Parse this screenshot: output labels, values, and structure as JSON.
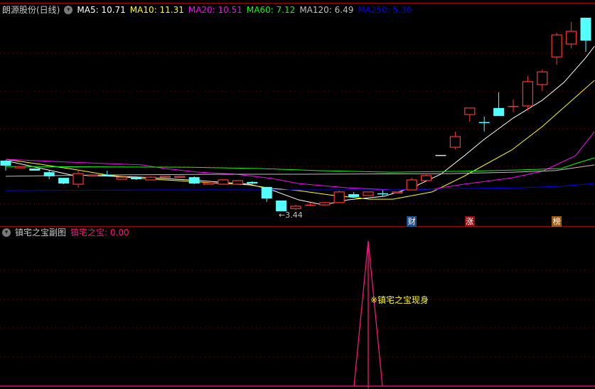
{
  "main_header": {
    "stock": "朗源股份(日线)",
    "ma_labels": [
      {
        "text": "MA5: 10.71",
        "color": "#ffffff"
      },
      {
        "text": "MA10: 11.31",
        "color": "#ffff00"
      },
      {
        "text": "MA20: 10.51",
        "color": "#ff00ff"
      },
      {
        "text": "MA60: 7.12",
        "color": "#00ff00"
      },
      {
        "text": "MA120: 6.49",
        "color": "#c0c0c0"
      },
      {
        "text": "MA250: 5.36",
        "color": "#0000ff"
      }
    ]
  },
  "sub_header": {
    "title": "镇宅之宝副图",
    "value_label": "镇宅之宝: 0.00"
  },
  "annotations": {
    "low": "←3.44",
    "signal": "※镇宅之宝现身",
    "tags": [
      {
        "text": "财",
        "bar": 28,
        "color": "#1c4f8c"
      },
      {
        "text": "涨",
        "bar": 32,
        "color": "#9a0e0e"
      },
      {
        "text": "榜",
        "bar": 38,
        "color": "#9c5a14"
      }
    ]
  },
  "colors": {
    "up": "#ff3232",
    "down": "#54ffff",
    "grid": "#8b0000",
    "sub_line": "#ff1080"
  },
  "chart_data": [
    {
      "type": "candlestick",
      "title": "朗源股份(日线)",
      "ylim": [
        3.1,
        12.0
      ],
      "ohlc": [
        [
          5.67,
          5.67,
          5.23,
          5.45
        ],
        [
          5.35,
          5.41,
          5.35,
          5.41
        ],
        [
          5.32,
          5.32,
          5.23,
          5.23
        ],
        [
          5.16,
          5.23,
          4.85,
          4.98
        ],
        [
          4.91,
          4.91,
          4.63,
          4.66
        ],
        [
          4.63,
          5.26,
          4.47,
          5.1
        ],
        [
          5.01,
          5.04,
          5.01,
          5.04
        ],
        [
          5.04,
          5.23,
          4.98,
          5.01
        ],
        [
          4.85,
          4.94,
          4.85,
          4.94
        ],
        [
          4.94,
          4.98,
          4.82,
          4.85
        ],
        [
          4.82,
          4.98,
          4.82,
          4.94
        ],
        [
          4.96,
          4.98,
          4.96,
          4.98
        ],
        [
          4.94,
          5.01,
          4.94,
          4.98
        ],
        [
          4.94,
          4.98,
          4.63,
          4.66
        ],
        [
          4.63,
          4.69,
          4.63,
          4.69
        ],
        [
          4.63,
          4.85,
          4.6,
          4.82
        ],
        [
          4.63,
          4.82,
          4.6,
          4.79
        ],
        [
          4.73,
          4.76,
          4.63,
          4.66
        ],
        [
          4.51,
          4.51,
          3.85,
          4.0
        ],
        [
          3.91,
          3.91,
          3.44,
          3.44
        ],
        [
          3.55,
          3.72,
          3.5,
          3.66
        ],
        [
          3.72,
          3.82,
          3.66,
          3.73
        ],
        [
          3.72,
          3.85,
          3.7,
          3.82
        ],
        [
          3.82,
          4.35,
          3.8,
          4.29
        ],
        [
          4.19,
          4.29,
          4.05,
          4.07
        ],
        [
          4.13,
          4.3,
          4.13,
          4.29
        ],
        [
          4.23,
          4.38,
          4.1,
          4.22
        ],
        [
          4.26,
          4.29,
          4.26,
          4.29
        ],
        [
          4.38,
          4.91,
          4.38,
          4.82
        ],
        [
          4.79,
          5.1,
          4.79,
          5.01
        ],
        [
          5.92,
          5.92,
          5.92,
          5.92
        ],
        [
          6.26,
          6.95,
          6.17,
          6.73
        ],
        [
          7.7,
          7.99,
          7.39,
          7.99
        ],
        [
          7.37,
          7.61,
          6.95,
          7.36
        ],
        [
          7.99,
          8.68,
          7.64,
          7.64
        ],
        [
          8.07,
          8.36,
          7.8,
          8.08
        ],
        [
          8.08,
          9.4,
          7.89,
          9.15
        ],
        [
          9.02,
          9.68,
          8.74,
          9.58
        ],
        [
          10.24,
          11.31,
          9.9,
          11.21
        ],
        [
          10.81,
          11.78,
          10.62,
          11.37
        ],
        [
          11.97,
          11.97,
          10.46,
          10.96
        ]
      ],
      "series": [
        {
          "name": "MA5",
          "color": "#ffffff",
          "points": [
            [
              0,
              5.67
            ],
            [
              4.5,
              5.04
            ],
            [
              9.4,
              4.94
            ],
            [
              13.3,
              4.79
            ],
            [
              16.8,
              4.63
            ],
            [
              18.2,
              4.41
            ],
            [
              20.2,
              3.94
            ],
            [
              21.9,
              3.72
            ],
            [
              23.6,
              3.94
            ],
            [
              26.1,
              4.1
            ],
            [
              28,
              4.47
            ],
            [
              30,
              5.07
            ],
            [
              31.5,
              5.82
            ],
            [
              33,
              6.61
            ],
            [
              35,
              7.55
            ],
            [
              37,
              8.33
            ],
            [
              38.5,
              9.12
            ],
            [
              40,
              10.21
            ],
            [
              40.6,
              10.71
            ]
          ]
        },
        {
          "name": "MA10",
          "color": "#ffff00",
          "points": [
            [
              0,
              5.73
            ],
            [
              2.4,
              5.51
            ],
            [
              4.66,
              5.29
            ],
            [
              7,
              5.04
            ],
            [
              8.8,
              4.91
            ],
            [
              11,
              4.82
            ],
            [
              14.3,
              4.69
            ],
            [
              16.8,
              4.6
            ],
            [
              18.4,
              4.44
            ],
            [
              20.2,
              4.35
            ],
            [
              22.3,
              4.16
            ],
            [
              25.1,
              3.97
            ],
            [
              26.7,
              3.97
            ],
            [
              29.4,
              4.29
            ],
            [
              31.6,
              4.98
            ],
            [
              34.9,
              6.14
            ],
            [
              37,
              7.17
            ],
            [
              40.6,
              9.21
            ]
          ]
        },
        {
          "name": "MA20",
          "color": "#ff00ff",
          "points": [
            [
              0,
              5.73
            ],
            [
              4.5,
              5.6
            ],
            [
              9.4,
              5.48
            ],
            [
              11,
              5.32
            ],
            [
              13.3,
              5.16
            ],
            [
              15.9,
              5.07
            ],
            [
              18.4,
              4.88
            ],
            [
              20.2,
              4.66
            ],
            [
              23.6,
              4.47
            ],
            [
              26.7,
              4.38
            ],
            [
              29.4,
              4.41
            ],
            [
              31.6,
              4.63
            ],
            [
              34.9,
              4.91
            ],
            [
              37,
              5.2
            ],
            [
              39.3,
              5.89
            ],
            [
              40.6,
              6.95
            ]
          ]
        },
        {
          "name": "MA60",
          "color": "#00ff00",
          "points": [
            [
              0,
              5.41
            ],
            [
              12.5,
              5.38
            ],
            [
              17.6,
              5.32
            ],
            [
              21.5,
              5.23
            ],
            [
              26.6,
              5.16
            ],
            [
              31.5,
              5.2
            ],
            [
              35.4,
              5.26
            ],
            [
              38.3,
              5.32
            ],
            [
              39.3,
              5.54
            ],
            [
              40.6,
              5.79
            ]
          ]
        },
        {
          "name": "MA120",
          "color": "#c0c0c0",
          "points": [
            [
              0,
              4.98
            ],
            [
              7,
              5.04
            ],
            [
              15,
              5.07
            ],
            [
              20.2,
              5.07
            ],
            [
              31,
              5.1
            ],
            [
              35,
              5.16
            ],
            [
              37.9,
              5.23
            ],
            [
              40.6,
              5.48
            ]
          ]
        },
        {
          "name": "MA250",
          "color": "#0000ff",
          "points": [
            [
              0,
              4.35
            ],
            [
              10.5,
              4.38
            ],
            [
              27.4,
              4.38
            ],
            [
              31.5,
              4.44
            ],
            [
              35.4,
              4.47
            ],
            [
              38.3,
              4.54
            ],
            [
              40.6,
              4.66
            ]
          ]
        }
      ]
    },
    {
      "type": "line",
      "title": "镇宅之宝副图",
      "ylim": [
        0,
        1
      ],
      "signal_bar": 25,
      "values_note_text": "镇宅之宝现身",
      "signal_value": 1,
      "base_value": 0
    }
  ]
}
